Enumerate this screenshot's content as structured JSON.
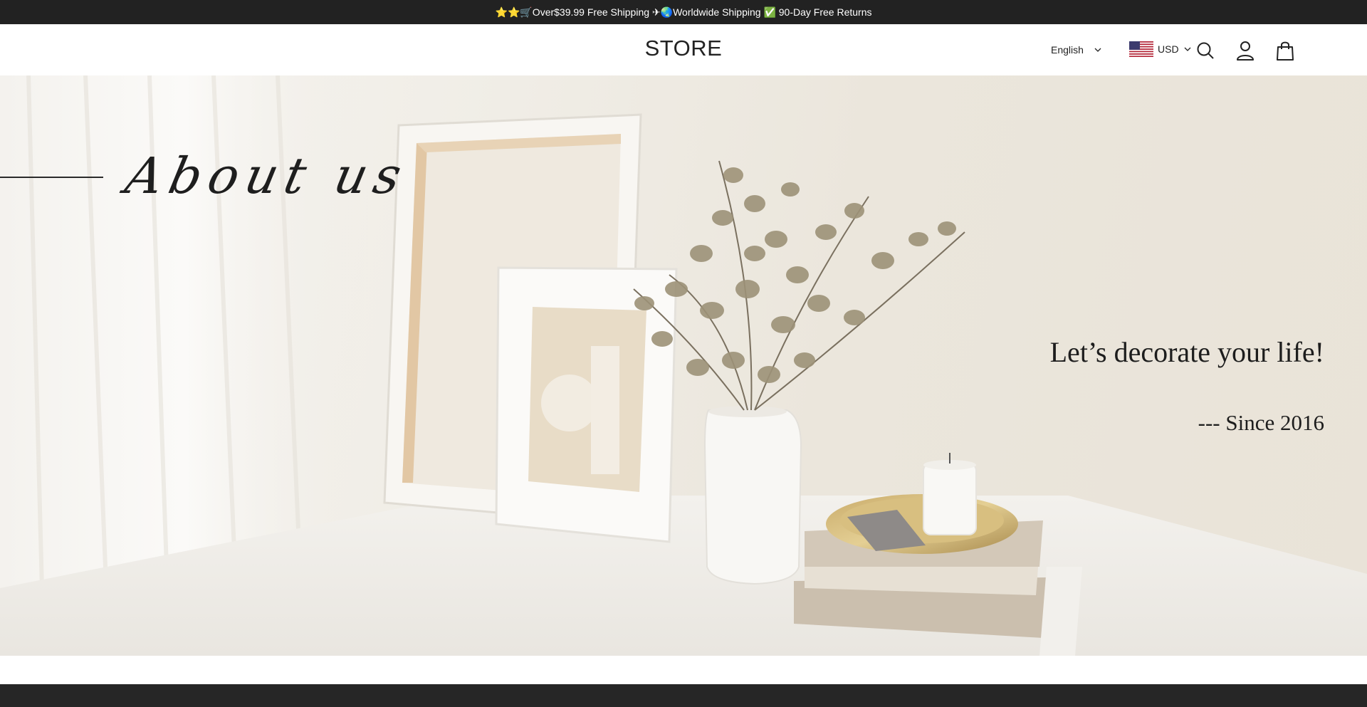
{
  "announcement": {
    "text": "⭐⭐🛒Over$39.99 Free Shipping ✈🌏Worldwide Shipping ✅ 90-Day Free Returns"
  },
  "header": {
    "logo": "STORE",
    "language": "English",
    "currency": "USD",
    "icons": [
      "search-icon",
      "account-icon",
      "cart-icon"
    ]
  },
  "hero": {
    "title": "About us",
    "tagline": "Let’s decorate your life!",
    "since": "--- Since 2016"
  },
  "colors": {
    "announcement_bg": "#222222",
    "footer_bg": "#262626",
    "text": "#1e1e1e"
  }
}
